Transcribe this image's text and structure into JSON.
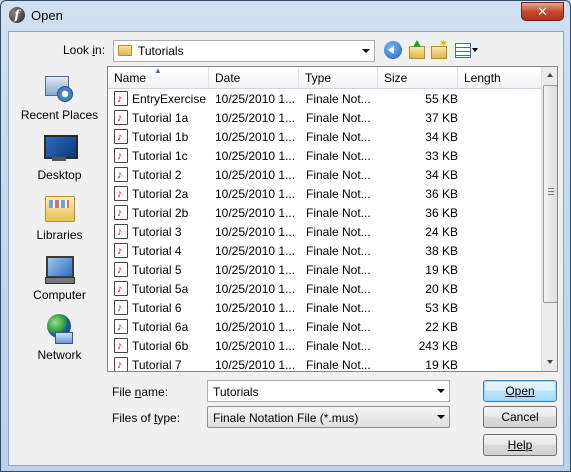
{
  "window": {
    "title": "Open",
    "close_label": "✕"
  },
  "lookin": {
    "label": "Look in:",
    "value": "Tutorials"
  },
  "places": [
    {
      "label": "Recent Places",
      "icon": "recent-places-icon"
    },
    {
      "label": "Desktop",
      "icon": "desktop-icon"
    },
    {
      "label": "Libraries",
      "icon": "libraries-icon"
    },
    {
      "label": "Computer",
      "icon": "computer-icon"
    },
    {
      "label": "Network",
      "icon": "network-icon"
    }
  ],
  "columns": [
    "Name",
    "Date",
    "Type",
    "Size",
    "Length"
  ],
  "files": [
    {
      "name": "EntryExercise",
      "date": "10/25/2010 1...",
      "type": "Finale Not...",
      "size": "55 KB"
    },
    {
      "name": "Tutorial 1a",
      "date": "10/25/2010 1...",
      "type": "Finale Not...",
      "size": "37 KB"
    },
    {
      "name": "Tutorial 1b",
      "date": "10/25/2010 1...",
      "type": "Finale Not...",
      "size": "34 KB"
    },
    {
      "name": "Tutorial 1c",
      "date": "10/25/2010 1...",
      "type": "Finale Not...",
      "size": "33 KB"
    },
    {
      "name": "Tutorial 2",
      "date": "10/25/2010 1...",
      "type": "Finale Not...",
      "size": "34 KB"
    },
    {
      "name": "Tutorial 2a",
      "date": "10/25/2010 1...",
      "type": "Finale Not...",
      "size": "36 KB"
    },
    {
      "name": "Tutorial 2b",
      "date": "10/25/2010 1...",
      "type": "Finale Not...",
      "size": "36 KB"
    },
    {
      "name": "Tutorial 3",
      "date": "10/25/2010 1...",
      "type": "Finale Not...",
      "size": "24 KB"
    },
    {
      "name": "Tutorial 4",
      "date": "10/25/2010 1...",
      "type": "Finale Not...",
      "size": "38 KB"
    },
    {
      "name": "Tutorial 5",
      "date": "10/25/2010 1...",
      "type": "Finale Not...",
      "size": "19 KB"
    },
    {
      "name": "Tutorial 5a",
      "date": "10/25/2010 1...",
      "type": "Finale Not...",
      "size": "20 KB"
    },
    {
      "name": "Tutorial 6",
      "date": "10/25/2010 1...",
      "type": "Finale Not...",
      "size": "53 KB"
    },
    {
      "name": "Tutorial 6a",
      "date": "10/25/2010 1...",
      "type": "Finale Not...",
      "size": "22 KB"
    },
    {
      "name": "Tutorial 6b",
      "date": "10/25/2010 1...",
      "type": "Finale Not...",
      "size": "243 KB"
    },
    {
      "name": "Tutorial 7",
      "date": "10/25/2010 1...",
      "type": "Finale Not...",
      "size": "19 KB"
    }
  ],
  "filename": {
    "label": "File name:",
    "value": "Tutorials"
  },
  "filetype": {
    "label": "Files of type:",
    "value": "Finale Notation File (*.mus)"
  },
  "buttons": {
    "open": "Open",
    "cancel": "Cancel",
    "help": "Help"
  }
}
